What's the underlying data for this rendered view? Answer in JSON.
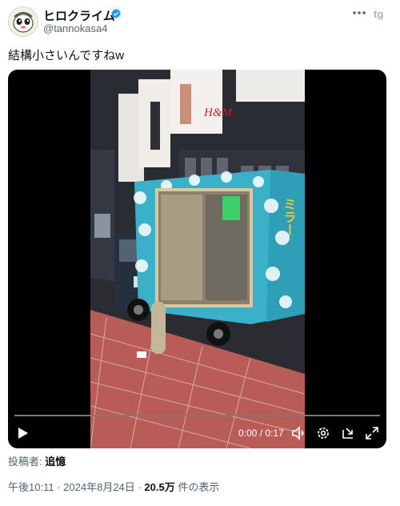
{
  "author": {
    "display_name": "ヒロクライム",
    "handle": "@tannokasa4",
    "verified_color": "#1d9bf0"
  },
  "tweet": {
    "text": "結構小さいんですねw"
  },
  "video": {
    "time": "0:00 / 0:17",
    "progress": 0,
    "icons": [
      "play-icon",
      "volume-icon",
      "settings-icon",
      "pop-out-icon",
      "fullscreen-icon"
    ],
    "scene": {
      "truck_sign": "ミラー",
      "billboard_text": "H&M"
    }
  },
  "contributor": {
    "label": "投稿者:",
    "name": "追憶"
  },
  "meta": {
    "time": "午後10:11",
    "separator": "·",
    "date": "2024年8月24日",
    "views": "20.5万",
    "views_suffix": "件の表示"
  }
}
